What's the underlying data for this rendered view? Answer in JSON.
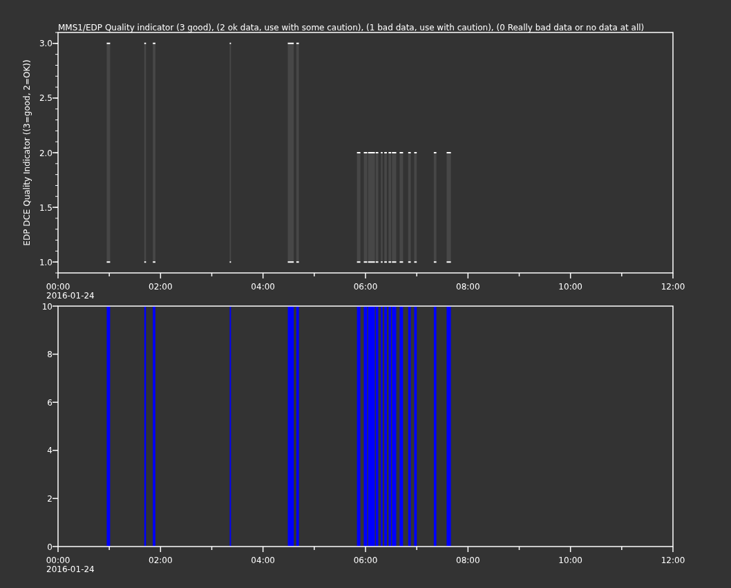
{
  "title": "MMS1/EDP  Quality indicator (3 good), (2 ok data, use with some caution), (1 bad data, use with caution), (0 Really bad data or no data at all)",
  "panels": [
    {
      "date_label": "2016-01-24",
      "chart_data": {
        "type": "area",
        "ylabel": "EDP DCE Quality Indicator ((3=good, 2=OK))",
        "xlim": [
          0,
          720
        ],
        "ylim": [
          0.9,
          3.1
        ],
        "xticks": [
          {
            "value": 0,
            "label": "00:00"
          },
          {
            "value": 120,
            "label": "02:00"
          },
          {
            "value": 240,
            "label": "04:00"
          },
          {
            "value": 360,
            "label": "06:00"
          },
          {
            "value": 480,
            "label": "08:00"
          },
          {
            "value": 600,
            "label": "10:00"
          },
          {
            "value": 720,
            "label": "12:00"
          }
        ],
        "yticks": [
          {
            "value": 1,
            "label": "1.0"
          },
          {
            "value": 1.5,
            "label": "1.5"
          },
          {
            "value": 2,
            "label": "2.0"
          },
          {
            "value": 2.5,
            "label": "2.5"
          },
          {
            "value": 3,
            "label": "3.0"
          }
        ],
        "x": [
          57,
          61,
          81,
          101,
          103,
          107,
          111,
          114,
          157.5,
          201,
          202.5,
          235.75,
          269,
          276,
          277.5,
          279,
          282,
          316,
          350,
          354,
          356,
          358,
          362,
          362.5,
          363,
          371,
          371.5,
          372,
          375,
          376.5,
          378,
          380,
          381,
          382,
          385,
          386,
          387,
          390,
          390.5,
          391,
          396,
          398,
          400,
          404,
          407,
          410,
          413,
          415,
          417,
          420,
          430,
          440,
          443,
          449,
          455,
          460
        ],
        "series": [
          {
            "color": "#474747",
            "values": [
              3,
              3,
              null,
              3,
              3,
              null,
              3,
              3,
              null,
              3,
              3,
              null,
              3,
              3,
              null,
              3,
              3,
              null,
              2,
              2,
              null,
              2,
              2,
              null,
              2,
              2,
              null,
              2,
              2,
              null,
              2,
              2,
              null,
              2,
              2,
              null,
              2,
              2,
              null,
              2,
              2,
              null,
              2,
              2,
              null,
              2,
              2,
              null,
              2,
              2,
              null,
              2,
              2,
              null,
              2,
              2
            ]
          }
        ]
      }
    },
    {
      "date_label": "2016-01-24",
      "chart_data": {
        "type": "area",
        "xlim": [
          0,
          720
        ],
        "ylim": [
          0,
          10
        ],
        "xticks": [
          {
            "value": 0,
            "label": "00:00"
          },
          {
            "value": 120,
            "label": "02:00"
          },
          {
            "value": 240,
            "label": "04:00"
          },
          {
            "value": 360,
            "label": "06:00"
          },
          {
            "value": 480,
            "label": "08:00"
          },
          {
            "value": 600,
            "label": "10:00"
          },
          {
            "value": 720,
            "label": "12:00"
          }
        ],
        "yticks": [
          {
            "value": 0,
            "label": "0"
          },
          {
            "value": 2,
            "label": "2"
          },
          {
            "value": 4,
            "label": "4"
          },
          {
            "value": 6,
            "label": "6"
          },
          {
            "value": 8,
            "label": "8"
          },
          {
            "value": 10,
            "label": "10"
          }
        ],
        "x": [
          57,
          61,
          81,
          101,
          103,
          107,
          111,
          114,
          157.5,
          201,
          202.5,
          235.75,
          269,
          276,
          277.5,
          279,
          282,
          316,
          350,
          354,
          356,
          358,
          362,
          362.5,
          363,
          371,
          371.5,
          372,
          375,
          376.5,
          378,
          380,
          381,
          382,
          385,
          386,
          387,
          390,
          390.5,
          391,
          396,
          398,
          400,
          404,
          407,
          410,
          413,
          415,
          417,
          420,
          430,
          440,
          443,
          449,
          455,
          460
        ],
        "series": [
          {
            "color": "#0000ff",
            "values": [
              10,
              10,
              null,
              10,
              10,
              null,
              10,
              10,
              null,
              10,
              10,
              null,
              10,
              10,
              null,
              10,
              10,
              null,
              10,
              10,
              null,
              10,
              10,
              null,
              10,
              10,
              null,
              10,
              10,
              null,
              10,
              10,
              null,
              10,
              10,
              null,
              10,
              10,
              null,
              10,
              10,
              null,
              10,
              10,
              null,
              10,
              10,
              null,
              10,
              10,
              null,
              10,
              10,
              null,
              10,
              10
            ]
          }
        ]
      }
    }
  ]
}
